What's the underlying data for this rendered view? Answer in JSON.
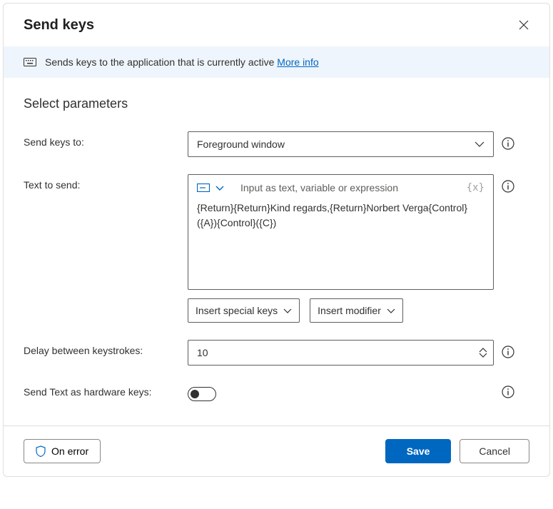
{
  "header": {
    "title": "Send keys"
  },
  "banner": {
    "text": "Sends keys to the application that is currently active ",
    "link": "More info"
  },
  "section": {
    "title": "Select parameters"
  },
  "fields": {
    "sendKeysTo": {
      "label": "Send keys to:",
      "value": "Foreground window"
    },
    "textToSend": {
      "label": "Text to send:",
      "placeholder": "Input as text, variable or expression",
      "varHint": "{x}",
      "value": "{Return}{Return}Kind regards,{Return}Norbert Verga{Control}({A}){Control}({C})"
    },
    "insertSpecial": {
      "label": "Insert special keys"
    },
    "insertModifier": {
      "label": "Insert modifier"
    },
    "delay": {
      "label": "Delay between keystrokes:",
      "value": "10"
    },
    "hardware": {
      "label": "Send Text as hardware keys:"
    }
  },
  "footer": {
    "onError": "On error",
    "save": "Save",
    "cancel": "Cancel"
  }
}
